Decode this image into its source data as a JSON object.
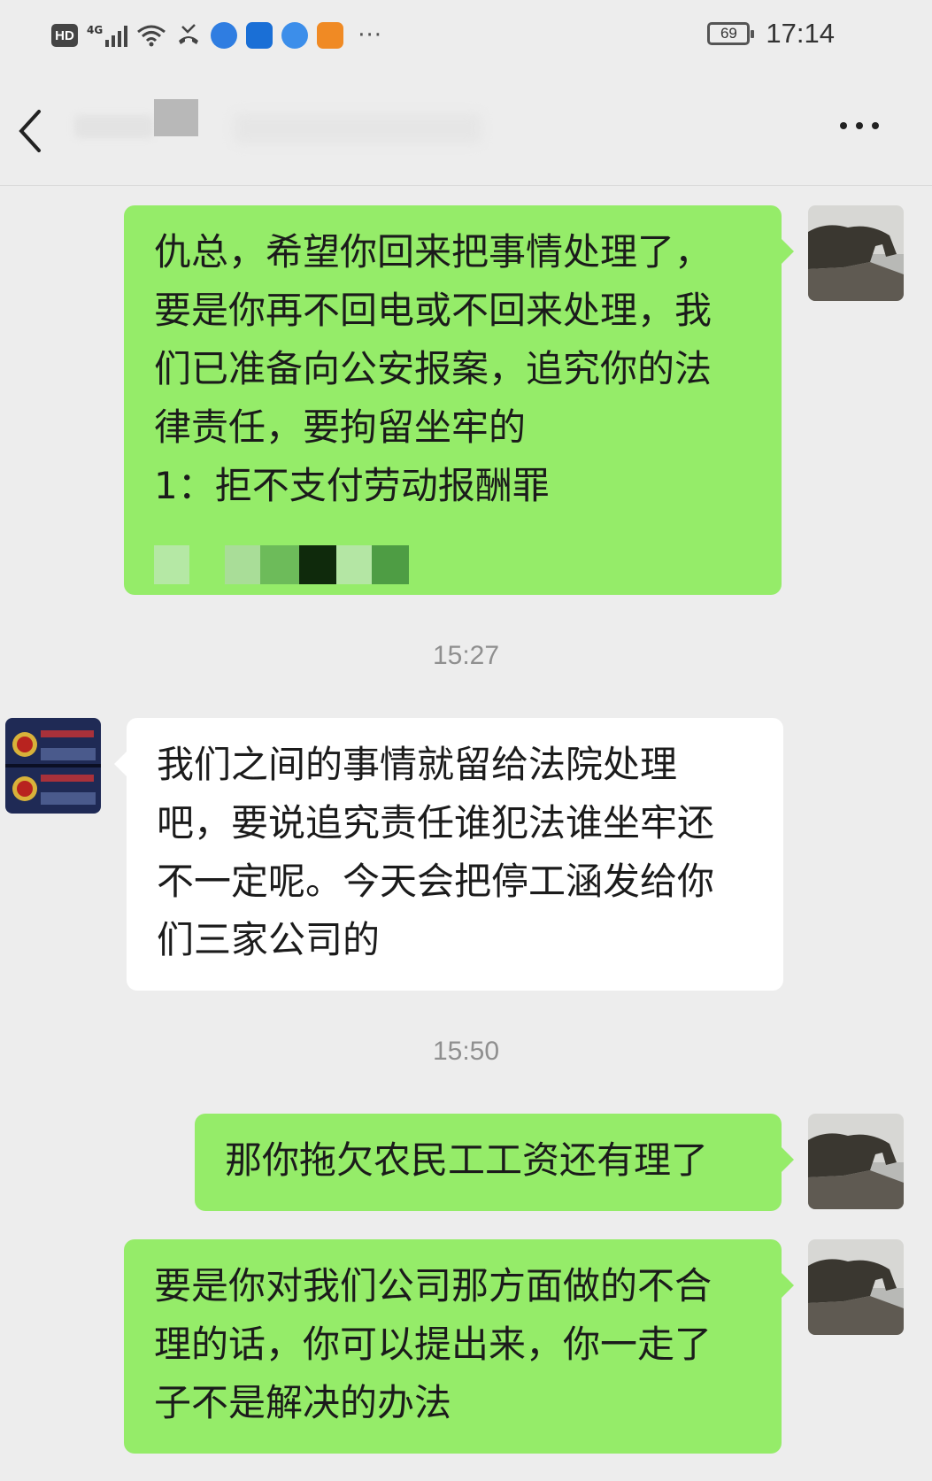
{
  "status_bar": {
    "network": "HD",
    "signal": "4G",
    "battery": "69",
    "time": "17:14",
    "more_indicator": "···"
  },
  "nav": {
    "back_icon": "chevron-left-icon",
    "more_icon": "more-dots-icon"
  },
  "messages": [
    {
      "side": "me",
      "lines": [
        "仇总，希望你回来把事情处理了，",
        "要是你再不回电或不回来处理，我",
        "们已准备向公安报案，追究你的法",
        "律责任，要拘留坐牢的",
        "1：拒不支付劳动报酬罪"
      ]
    },
    {
      "timestamp": "15:27"
    },
    {
      "side": "them",
      "lines": [
        "我们之间的事情就留给法院处理",
        "吧，要说追究责任谁犯法谁坐牢还",
        "不一定呢。今天会把停工涵发给你",
        "们三家公司的"
      ]
    },
    {
      "timestamp": "15:50"
    },
    {
      "side": "me",
      "lines": [
        "那你拖欠农民工工资还有理了"
      ]
    },
    {
      "side": "me",
      "lines": [
        "要是你对我们公司那方面做的不合",
        "理的话，你可以提出来，你一走了",
        "子不是解决的办法"
      ]
    }
  ],
  "colors": {
    "background": "#ededed",
    "my_bubble": "#95ec69",
    "their_bubble": "#ffffff",
    "timestamp": "#8f8f8f"
  }
}
